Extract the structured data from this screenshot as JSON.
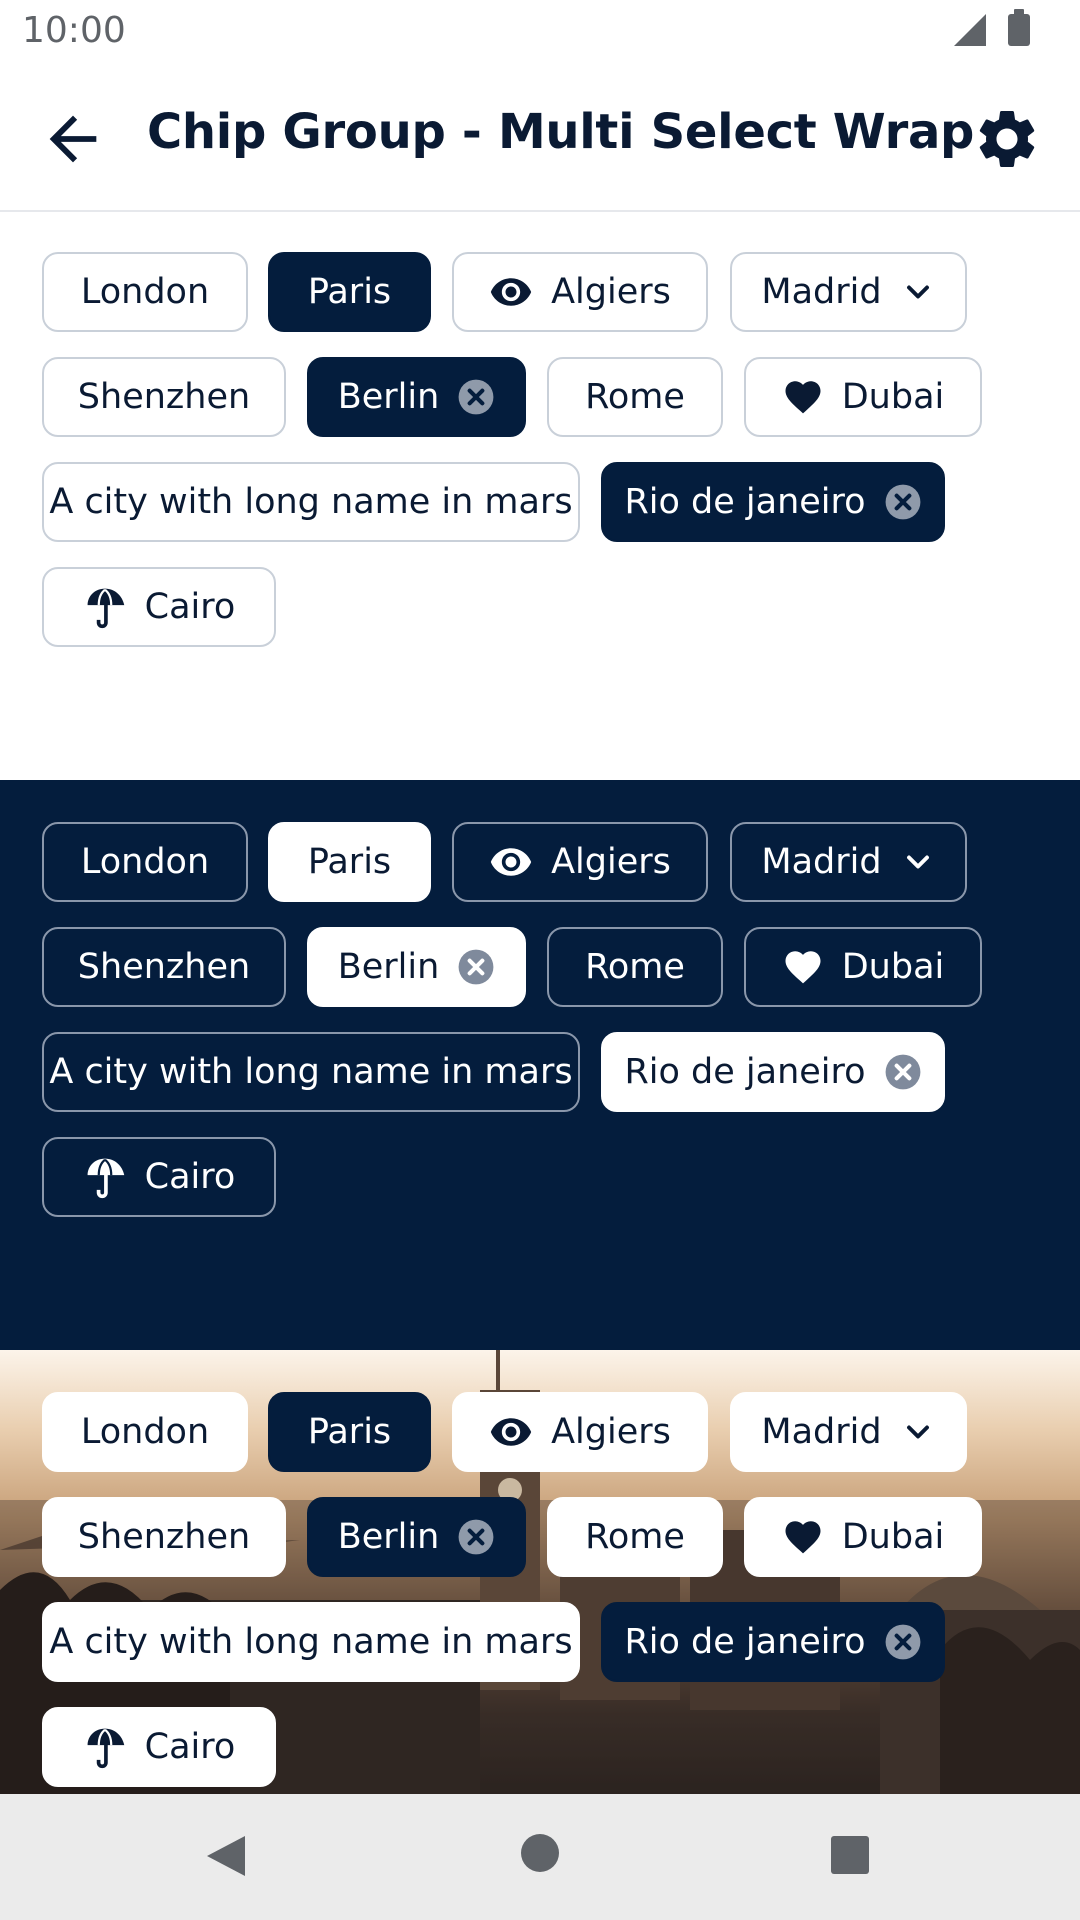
{
  "status_bar": {
    "time": "10:00"
  },
  "app_bar": {
    "title": "Chip Group - Multi Select Wrap"
  },
  "chips": {
    "london": "London",
    "paris": "Paris",
    "algiers": "Algiers",
    "madrid": "Madrid",
    "shenzhen": "Shenzhen",
    "berlin": "Berlin",
    "rome": "Rome",
    "dubai": "Dubai",
    "long_city": "A city with long name in mars",
    "rio": "Rio de janeiro",
    "cairo": "Cairo"
  },
  "selected_chips": [
    "Paris",
    "Berlin",
    "Rio de janeiro"
  ],
  "sections": [
    "light",
    "dark",
    "photo"
  ],
  "icons": {
    "algiers": "eye-icon",
    "madrid": "chevron-down-icon",
    "berlin": "close-circle-icon",
    "dubai": "heart-icon",
    "rio": "close-circle-icon",
    "cairo": "umbrella-icon"
  },
  "colors": {
    "primary": "#041d3d",
    "chip_border_light": "#c9d0d9",
    "surface": "#ffffff"
  }
}
